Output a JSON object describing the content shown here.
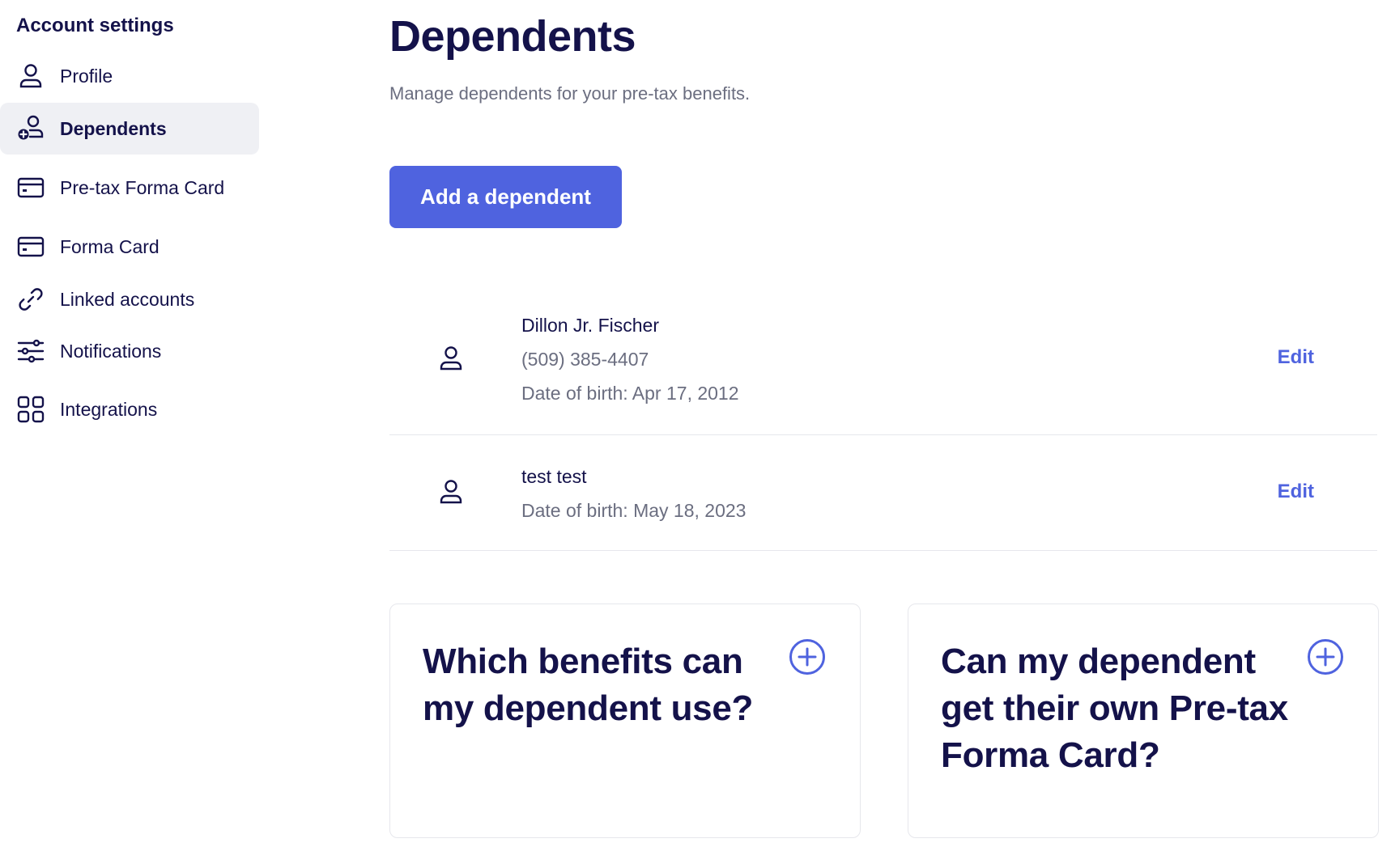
{
  "sidebar": {
    "title": "Account settings",
    "items": [
      {
        "label": "Profile",
        "icon": "user-icon"
      },
      {
        "label": "Dependents",
        "icon": "user-plus-icon",
        "active": true
      },
      {
        "label": "Pre-tax Forma Card",
        "icon": "credit-card-icon"
      },
      {
        "label": "Forma Card",
        "icon": "credit-card-icon"
      },
      {
        "label": "Linked accounts",
        "icon": "link-icon"
      },
      {
        "label": "Notifications",
        "icon": "sliders-icon"
      },
      {
        "label": "Integrations",
        "icon": "grid-icon"
      }
    ]
  },
  "main": {
    "title": "Dependents",
    "subtitle": "Manage dependents for your pre-tax benefits.",
    "add_button_label": "Add a dependent",
    "dependents": [
      {
        "name": "Dillon Jr. Fischer",
        "phone": "(509) 385-4407",
        "dob": "Date of birth: Apr 17, 2012",
        "edit_label": "Edit"
      },
      {
        "name": "test test",
        "dob": "Date of birth: May 18, 2023",
        "edit_label": "Edit"
      }
    ],
    "faq": [
      {
        "question": "Which benefits can my dependent use?",
        "icon": "plus-circle-icon"
      },
      {
        "question": "Can my dependent get their own Pre-tax Forma Card?",
        "icon": "plus-circle-icon"
      }
    ]
  },
  "colors": {
    "accent": "#4f63df",
    "text_primary": "#14124a",
    "text_secondary": "#6b6e80",
    "active_nav_bg": "#eff0f4"
  }
}
